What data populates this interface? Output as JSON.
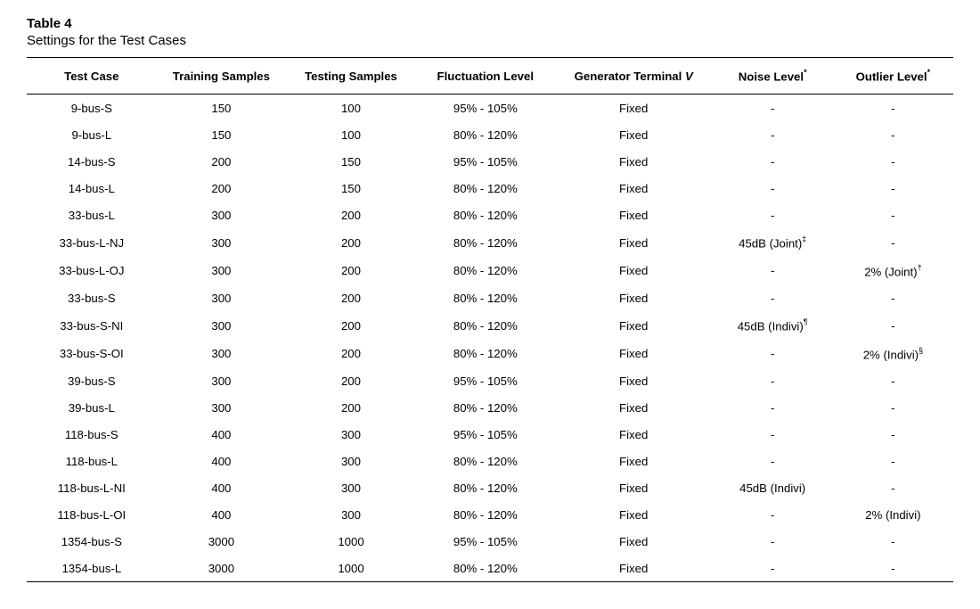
{
  "table": {
    "label": "Table 4",
    "caption": "Settings for the Test Cases",
    "headers": {
      "case": "Test Case",
      "train": "Training Samples",
      "test": "Testing Samples",
      "fluct": "Fluctuation Level",
      "genv_prefix": "Generator Terminal ",
      "genv_var": "V",
      "noise": "Noise Level",
      "noise_mark": "*",
      "outlier": "Outlier Level",
      "outlier_mark": "*"
    },
    "rows": [
      {
        "case": "9-bus-S",
        "train": "150",
        "test": "100",
        "fluct": "95% - 105%",
        "genv": "Fixed",
        "noise": "-",
        "noise_mark": "",
        "outlier": "-",
        "outlier_mark": ""
      },
      {
        "case": "9-bus-L",
        "train": "150",
        "test": "100",
        "fluct": "80% - 120%",
        "genv": "Fixed",
        "noise": "-",
        "noise_mark": "",
        "outlier": "-",
        "outlier_mark": ""
      },
      {
        "case": "14-bus-S",
        "train": "200",
        "test": "150",
        "fluct": "95% - 105%",
        "genv": "Fixed",
        "noise": "-",
        "noise_mark": "",
        "outlier": "-",
        "outlier_mark": ""
      },
      {
        "case": "14-bus-L",
        "train": "200",
        "test": "150",
        "fluct": "80% - 120%",
        "genv": "Fixed",
        "noise": "-",
        "noise_mark": "",
        "outlier": "-",
        "outlier_mark": ""
      },
      {
        "case": "33-bus-L",
        "train": "300",
        "test": "200",
        "fluct": "80% - 120%",
        "genv": "Fixed",
        "noise": "-",
        "noise_mark": "",
        "outlier": "-",
        "outlier_mark": ""
      },
      {
        "case": "33-bus-L-NJ",
        "train": "300",
        "test": "200",
        "fluct": "80% - 120%",
        "genv": "Fixed",
        "noise": "45dB (Joint)",
        "noise_mark": "‡",
        "outlier": "-",
        "outlier_mark": ""
      },
      {
        "case": "33-bus-L-OJ",
        "train": "300",
        "test": "200",
        "fluct": "80% - 120%",
        "genv": "Fixed",
        "noise": "-",
        "noise_mark": "",
        "outlier": "2% (Joint)",
        "outlier_mark": "†"
      },
      {
        "case": "33-bus-S",
        "train": "300",
        "test": "200",
        "fluct": "80% - 120%",
        "genv": "Fixed",
        "noise": "-",
        "noise_mark": "",
        "outlier": "-",
        "outlier_mark": ""
      },
      {
        "case": "33-bus-S-NI",
        "train": "300",
        "test": "200",
        "fluct": "80% - 120%",
        "genv": "Fixed",
        "noise": "45dB (Indivi)",
        "noise_mark": "¶",
        "outlier": "-",
        "outlier_mark": ""
      },
      {
        "case": "33-bus-S-OI",
        "train": "300",
        "test": "200",
        "fluct": "80% - 120%",
        "genv": "Fixed",
        "noise": "-",
        "noise_mark": "",
        "outlier": "2% (Indivi)",
        "outlier_mark": "§"
      },
      {
        "case": "39-bus-S",
        "train": "300",
        "test": "200",
        "fluct": "95% - 105%",
        "genv": "Fixed",
        "noise": "-",
        "noise_mark": "",
        "outlier": "-",
        "outlier_mark": ""
      },
      {
        "case": "39-bus-L",
        "train": "300",
        "test": "200",
        "fluct": "80% - 120%",
        "genv": "Fixed",
        "noise": "-",
        "noise_mark": "",
        "outlier": "-",
        "outlier_mark": ""
      },
      {
        "case": "118-bus-S",
        "train": "400",
        "test": "300",
        "fluct": "95% - 105%",
        "genv": "Fixed",
        "noise": "-",
        "noise_mark": "",
        "outlier": "-",
        "outlier_mark": ""
      },
      {
        "case": "118-bus-L",
        "train": "400",
        "test": "300",
        "fluct": "80% - 120%",
        "genv": "Fixed",
        "noise": "-",
        "noise_mark": "",
        "outlier": "-",
        "outlier_mark": ""
      },
      {
        "case": "118-bus-L-NI",
        "train": "400",
        "test": "300",
        "fluct": "80% - 120%",
        "genv": "Fixed",
        "noise": "45dB (Indivi)",
        "noise_mark": "",
        "outlier": "-",
        "outlier_mark": ""
      },
      {
        "case": "118-bus-L-OI",
        "train": "400",
        "test": "300",
        "fluct": "80% - 120%",
        "genv": "Fixed",
        "noise": "-",
        "noise_mark": "",
        "outlier": "2% (Indivi)",
        "outlier_mark": ""
      },
      {
        "case": "1354-bus-S",
        "train": "3000",
        "test": "1000",
        "fluct": "95% - 105%",
        "genv": "Fixed",
        "noise": "-",
        "noise_mark": "",
        "outlier": "-",
        "outlier_mark": ""
      },
      {
        "case": "1354-bus-L",
        "train": "3000",
        "test": "1000",
        "fluct": "80% - 120%",
        "genv": "Fixed",
        "noise": "-",
        "noise_mark": "",
        "outlier": "-",
        "outlier_mark": ""
      }
    ]
  }
}
